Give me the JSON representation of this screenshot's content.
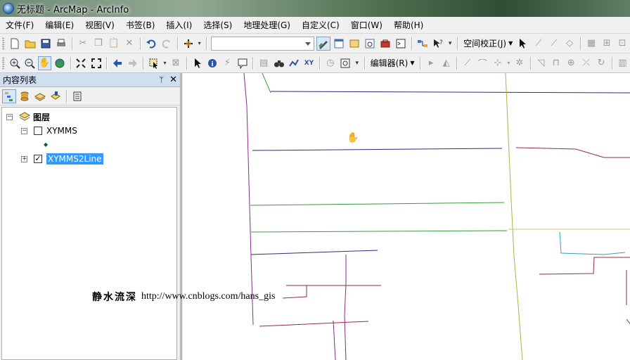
{
  "window": {
    "title": "无标题 - ArcMap - ArcInfo"
  },
  "menu": {
    "items": [
      "文件(F)",
      "编辑(E)",
      "视图(V)",
      "书签(B)",
      "插入(I)",
      "选择(S)",
      "地理处理(G)",
      "自定义(C)",
      "窗口(W)",
      "帮助(H)"
    ]
  },
  "toolbar": {
    "spatial_adjust_label": "空间校正(J)",
    "editor_label": "编辑器(R)",
    "scale_value": ""
  },
  "toc": {
    "title": "内容列表",
    "pin_label": "ᛘ",
    "close_label": "✕",
    "root_label": "图层",
    "layers": [
      {
        "name": "XYMMS",
        "checked": false,
        "expanded": true,
        "symbol": "◆"
      },
      {
        "name": "XYMMS2Line",
        "checked": true,
        "expanded": false,
        "selected": true
      }
    ]
  },
  "watermark": {
    "cn": "静水流深",
    "url": "http://www.cnblogs.com/hans_gis"
  },
  "colors": {
    "titlebar": "#5f7f64",
    "panel_header": "#cfdff0",
    "selection": "#3399ff",
    "line_navy": "#2b2b8a",
    "line_green": "#3a9a3a",
    "line_red": "#9a2a3a",
    "line_purple": "#8a2a8a",
    "line_olive": "#b8b040",
    "line_teal": "#3aa0b0"
  }
}
